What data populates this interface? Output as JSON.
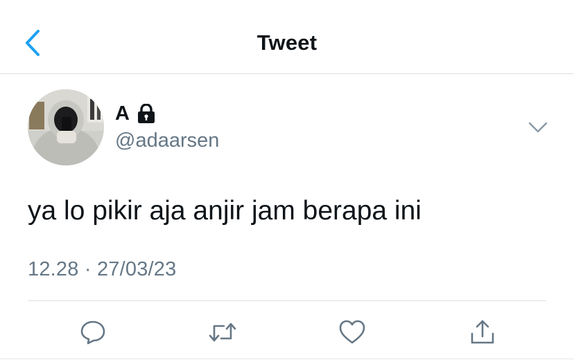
{
  "header": {
    "title": "Tweet",
    "back_icon": "chevron-left-icon"
  },
  "colors": {
    "accent": "#1da1f2",
    "secondary_text": "#657786",
    "icon": "#657786",
    "divider": "#dcdfe2"
  },
  "tweet": {
    "author": {
      "display_name": "A",
      "handle": "@adaarsen",
      "protected": true
    },
    "text": "ya lo pikir aja anjir jam berapa ini",
    "time": "12.28",
    "separator": "·",
    "date": "27/03/23"
  },
  "actions": [
    {
      "name": "reply",
      "icon": "reply-icon"
    },
    {
      "name": "retweet",
      "icon": "retweet-icon"
    },
    {
      "name": "like",
      "icon": "heart-icon"
    },
    {
      "name": "share",
      "icon": "share-icon"
    }
  ]
}
